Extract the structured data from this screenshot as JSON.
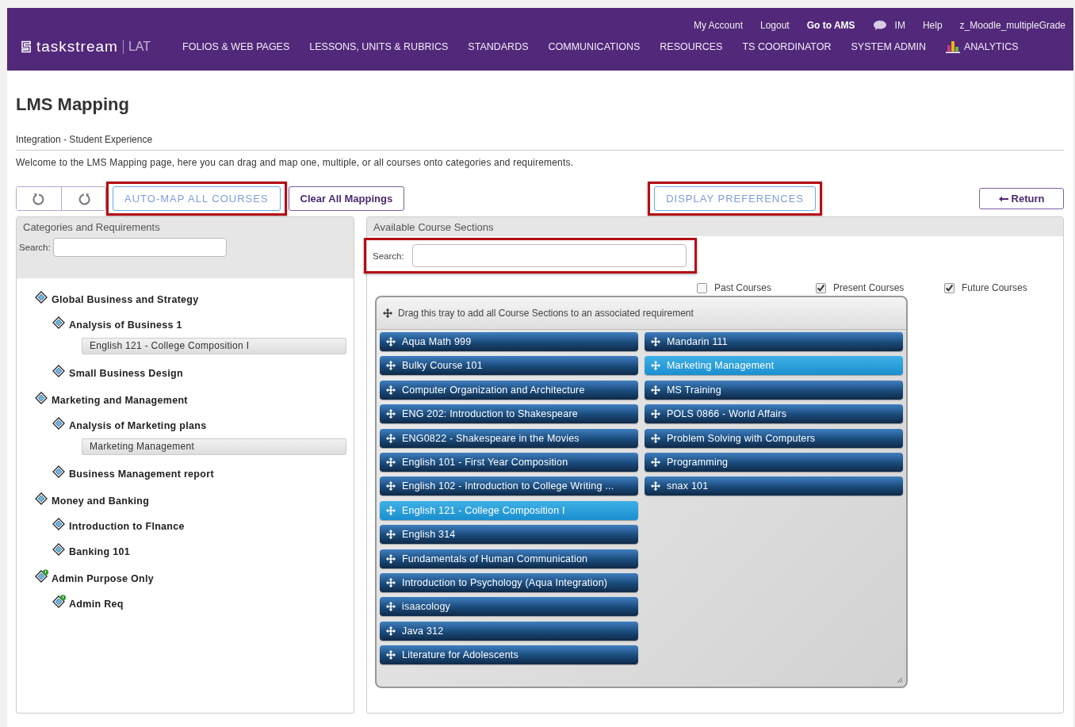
{
  "header": {
    "logo": "taskstream",
    "logo_suffix": "LAT",
    "top_links": [
      {
        "label": "My Account",
        "bold": false,
        "kind": "text"
      },
      {
        "label": "Logout",
        "bold": false,
        "kind": "text"
      },
      {
        "label": "Go to AMS",
        "bold": true,
        "kind": "text"
      },
      {
        "label": "IM",
        "bold": false,
        "kind": "chat"
      },
      {
        "label": "Help",
        "bold": false,
        "kind": "text"
      },
      {
        "label": "z_Moodle_multipleGrade",
        "bold": false,
        "kind": "text"
      }
    ],
    "nav": [
      {
        "label": "FOLIOS & WEB PAGES",
        "kind": "text"
      },
      {
        "label": "LESSONS, UNITS & RUBRICS",
        "kind": "text"
      },
      {
        "label": "STANDARDS",
        "kind": "text"
      },
      {
        "label": "COMMUNICATIONS",
        "kind": "text"
      },
      {
        "label": "RESOURCES",
        "kind": "text"
      },
      {
        "label": "TS COORDINATOR",
        "kind": "text"
      },
      {
        "label": "SYSTEM ADMIN",
        "kind": "text"
      },
      {
        "label": "ANALYTICS",
        "kind": "analytics"
      }
    ]
  },
  "page_title": "LMS Mapping",
  "breadcrumb": "Integration - Student Experience",
  "intro": "Welcome to the LMS Mapping page, here you can drag and map one, multiple, or all courses onto categories and requirements.",
  "toolbar": {
    "auto_map": {
      "label": "AUTO-MAP ALL COURSES",
      "highlighted": true
    },
    "clear": {
      "label": "Clear All Mappings"
    },
    "display_prefs": {
      "label": "DISPLAY PREFERENCES",
      "highlighted": true
    },
    "return": {
      "label": "Return"
    }
  },
  "left_panel": {
    "title": "Categories and Requirements",
    "search_label": "Search:",
    "tree": [
      {
        "label": "Global Business and Strategy",
        "flagged": false,
        "children": [
          {
            "label": "Analysis of Business 1",
            "flagged": false,
            "mapped": [
              "English 121 - College Composition I"
            ]
          },
          {
            "label": "Small Business Design",
            "flagged": false
          }
        ]
      },
      {
        "label": "Marketing and Management",
        "flagged": false,
        "children": [
          {
            "label": "Analysis of Marketing plans",
            "flagged": false,
            "mapped": [
              "Marketing Management"
            ]
          },
          {
            "label": "Business Management report",
            "flagged": false
          }
        ]
      },
      {
        "label": "Money and Banking",
        "flagged": false,
        "children": [
          {
            "label": "Introduction to FInance",
            "flagged": false
          },
          {
            "label": "Banking 101",
            "flagged": false
          }
        ]
      },
      {
        "label": "Admin Purpose Only",
        "flagged": true,
        "children": [
          {
            "label": "Admin Req",
            "flagged": true
          }
        ]
      }
    ]
  },
  "right_panel": {
    "title": "Available Course Sections",
    "search_label": "Search:",
    "search_highlighted": true,
    "filters": [
      {
        "label": "Past Courses",
        "checked": false
      },
      {
        "label": "Present Courses",
        "checked": true
      },
      {
        "label": "Future Courses",
        "checked": true
      }
    ],
    "tray_label": "Drag this tray to add all Course Sections to an associated requirement",
    "course_columns": [
      {
        "courses": [
          {
            "label": "Aqua Math 999",
            "selected": false
          },
          {
            "label": "Bulky Course 101",
            "selected": false
          },
          {
            "label": "Computer Organization and Architecture",
            "selected": false
          },
          {
            "label": "ENG 202: Introduction to Shakespeare",
            "selected": false
          },
          {
            "label": "ENG0822 - Shakespeare in the Movies",
            "selected": false
          },
          {
            "label": "English 101 - First Year Composition",
            "selected": false
          },
          {
            "label": "English 102 - Introduction to College Writing ...",
            "selected": false
          },
          {
            "label": "English 121 - College Composition I",
            "selected": true
          },
          {
            "label": "English 314",
            "selected": false
          },
          {
            "label": "Fundamentals of Human Communication",
            "selected": false
          },
          {
            "label": "Introduction to Psychology (Aqua Integration)",
            "selected": false
          },
          {
            "label": "isaacology",
            "selected": false
          },
          {
            "label": "Java 312",
            "selected": false
          },
          {
            "label": "Literature for Adolescents",
            "selected": false
          }
        ]
      },
      {
        "courses": [
          {
            "label": "Mandarin 111",
            "selected": false
          },
          {
            "label": "Marketing Management",
            "selected": true
          },
          {
            "label": "MS Training",
            "selected": false
          },
          {
            "label": "POLS 0866 - World Affairs",
            "selected": false
          },
          {
            "label": "Problem Solving with Computers",
            "selected": false
          },
          {
            "label": "Programming",
            "selected": false
          },
          {
            "label": "snax 101",
            "selected": false
          }
        ]
      }
    ]
  }
}
